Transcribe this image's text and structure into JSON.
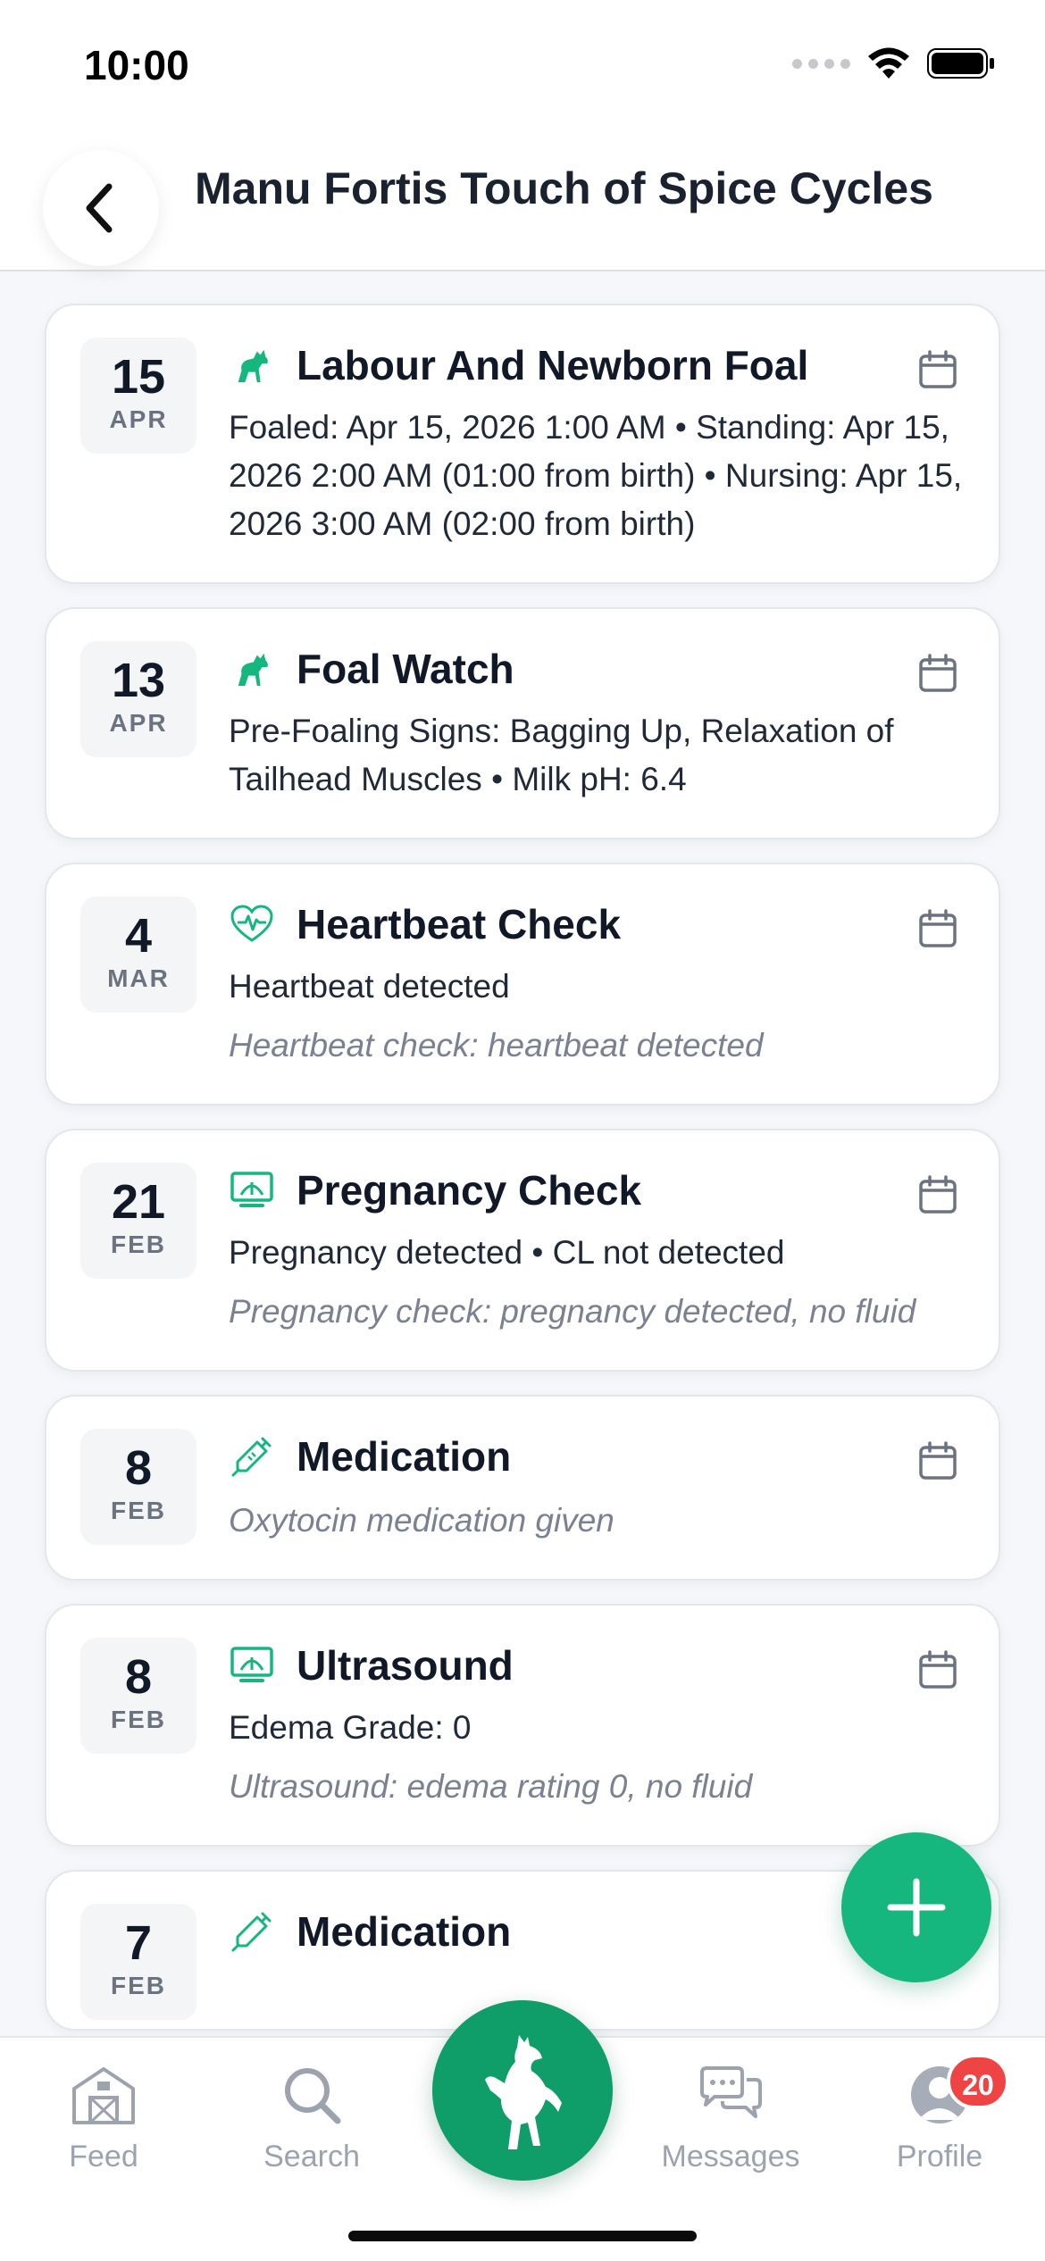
{
  "status_bar": {
    "time": "10:00"
  },
  "header": {
    "title": "Manu Fortis Touch of Spice Cycles"
  },
  "colors": {
    "accent": "#15b77e",
    "accent_dark": "#0f9d6a",
    "badge": "#ef4444"
  },
  "cards": [
    {
      "day": "15",
      "month": "APR",
      "icon": "horse-icon",
      "title": "Labour And Newborn Foal",
      "details": "Foaled: Apr 15, 2026 1:00 AM • Standing: Apr 15, 2026 2:00 AM (01:00 from birth) • Nursing: Apr 15, 2026 3:00 AM (02:00 from birth)",
      "note": ""
    },
    {
      "day": "13",
      "month": "APR",
      "icon": "horse-icon",
      "title": "Foal Watch",
      "details": "Pre-Foaling Signs: Bagging Up, Relaxation of Tailhead Muscles • Milk pH: 6.4",
      "note": ""
    },
    {
      "day": "4",
      "month": "MAR",
      "icon": "heartbeat-icon",
      "title": "Heartbeat Check",
      "details": "Heartbeat detected",
      "note": "Heartbeat check: heartbeat detected"
    },
    {
      "day": "21",
      "month": "FEB",
      "icon": "ultrasound-icon",
      "title": "Pregnancy Check",
      "details": "Pregnancy detected • CL not detected",
      "note": "Pregnancy check: pregnancy detected, no fluid"
    },
    {
      "day": "8",
      "month": "FEB",
      "icon": "syringe-icon",
      "title": "Medication",
      "details": "",
      "note": "Oxytocin medication given"
    },
    {
      "day": "8",
      "month": "FEB",
      "icon": "ultrasound-icon",
      "title": "Ultrasound",
      "details": "Edema Grade: 0",
      "note": "Ultrasound: edema rating 0, no fluid"
    },
    {
      "day": "7",
      "month": "FEB",
      "icon": "syringe-icon",
      "title": "Medication",
      "details": "",
      "note": ""
    }
  ],
  "nav": {
    "feed": "Feed",
    "search": "Search",
    "messages": "Messages",
    "profile": "Profile",
    "profile_badge": "20"
  }
}
